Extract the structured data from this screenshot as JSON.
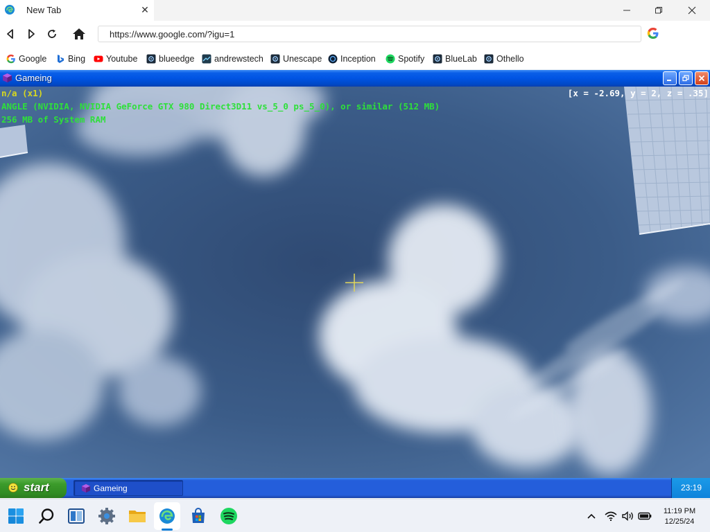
{
  "browser": {
    "tab_title": "New Tab",
    "tab_close": "✕",
    "url": "https://www.google.com/?igu=1",
    "bookmarks": [
      {
        "label": "Google",
        "icon": "google-icon"
      },
      {
        "label": "Bing",
        "icon": "bing-icon"
      },
      {
        "label": "Youtube",
        "icon": "youtube-icon"
      },
      {
        "label": "blueedge",
        "icon": "app-icon"
      },
      {
        "label": "andrewstech",
        "icon": "app-icon"
      },
      {
        "label": "Unescape",
        "icon": "app-icon"
      },
      {
        "label": "Inception",
        "icon": "app-icon"
      },
      {
        "label": "Spotify",
        "icon": "spotify-icon"
      },
      {
        "label": "BlueLab",
        "icon": "app-icon"
      },
      {
        "label": "Othello",
        "icon": "app-icon"
      }
    ]
  },
  "game_window": {
    "title": "Gameing",
    "hud": {
      "line1": "n/a (x1)",
      "line2": "ANGLE (NVIDIA, NVIDIA GeForce GTX 980 Direct3D11 vs_5_0 ps_5_0), or similar (512 MB)",
      "line3": "256 MB of System RAM",
      "coords": "[x = -2.69, y = 2, z = .35]"
    }
  },
  "xp_taskbar": {
    "start_label": "start",
    "task_label": "Gameing",
    "clock": "23:19"
  },
  "win_taskbar": {
    "time": "11:19 PM",
    "date": "12/25/24"
  },
  "colors": {
    "xp_title_blue": "#0054e3",
    "xp_start_green": "#3c9b2b",
    "hud_yellow": "#d8d820",
    "hud_green": "#2ee03a",
    "sky_blue": "#3a5a86"
  }
}
